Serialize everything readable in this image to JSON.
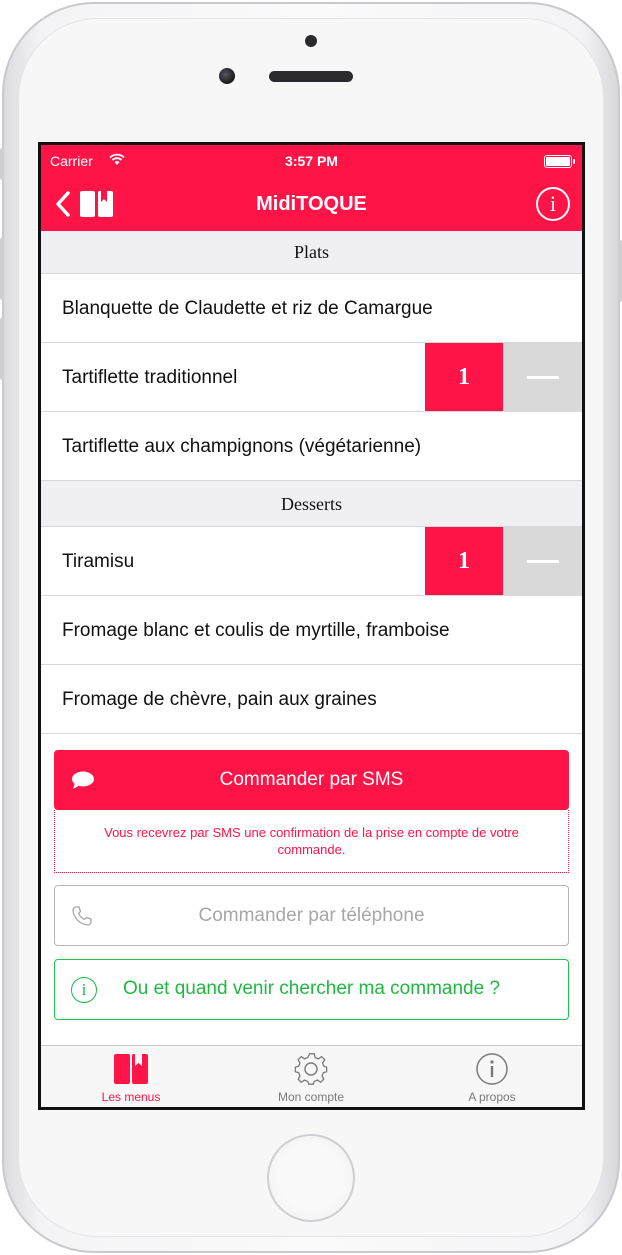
{
  "status_bar": {
    "carrier": "Carrier",
    "time": "3:57 PM"
  },
  "nav": {
    "title": "MidiTOQUE",
    "info_glyph": "i"
  },
  "colors": {
    "accent": "#ff1447",
    "green": "#1fb843",
    "section_bg": "#efeff4"
  },
  "sections": [
    {
      "title": "Plats",
      "items": [
        {
          "label": "Blanquette de Claudette et riz de Camargue",
          "quantity": null
        },
        {
          "label": "Tartiflette traditionnel",
          "quantity": "1"
        },
        {
          "label": "Tartiflette aux champignons (végétarienne)",
          "quantity": null
        }
      ]
    },
    {
      "title": "Desserts",
      "items": [
        {
          "label": "Tiramisu",
          "quantity": "1"
        },
        {
          "label": "Fromage blanc et coulis de myrtille, framboise",
          "quantity": null
        },
        {
          "label": "Fromage de chèvre, pain aux graines",
          "quantity": null
        }
      ]
    }
  ],
  "actions": {
    "sms_label": "Commander par SMS",
    "sms_note": "Vous recevrez par SMS une confirmation de la prise en compte de votre commande.",
    "phone_label": "Commander par téléphone",
    "where_label": "Ou et quand venir chercher ma commande ?",
    "where_glyph": "i"
  },
  "tabs": [
    {
      "label": "Les menus",
      "icon": "menu-book-icon",
      "active": true
    },
    {
      "label": "Mon compte",
      "icon": "gear-icon",
      "active": false
    },
    {
      "label": "A propos",
      "icon": "info-icon",
      "active": false
    }
  ]
}
